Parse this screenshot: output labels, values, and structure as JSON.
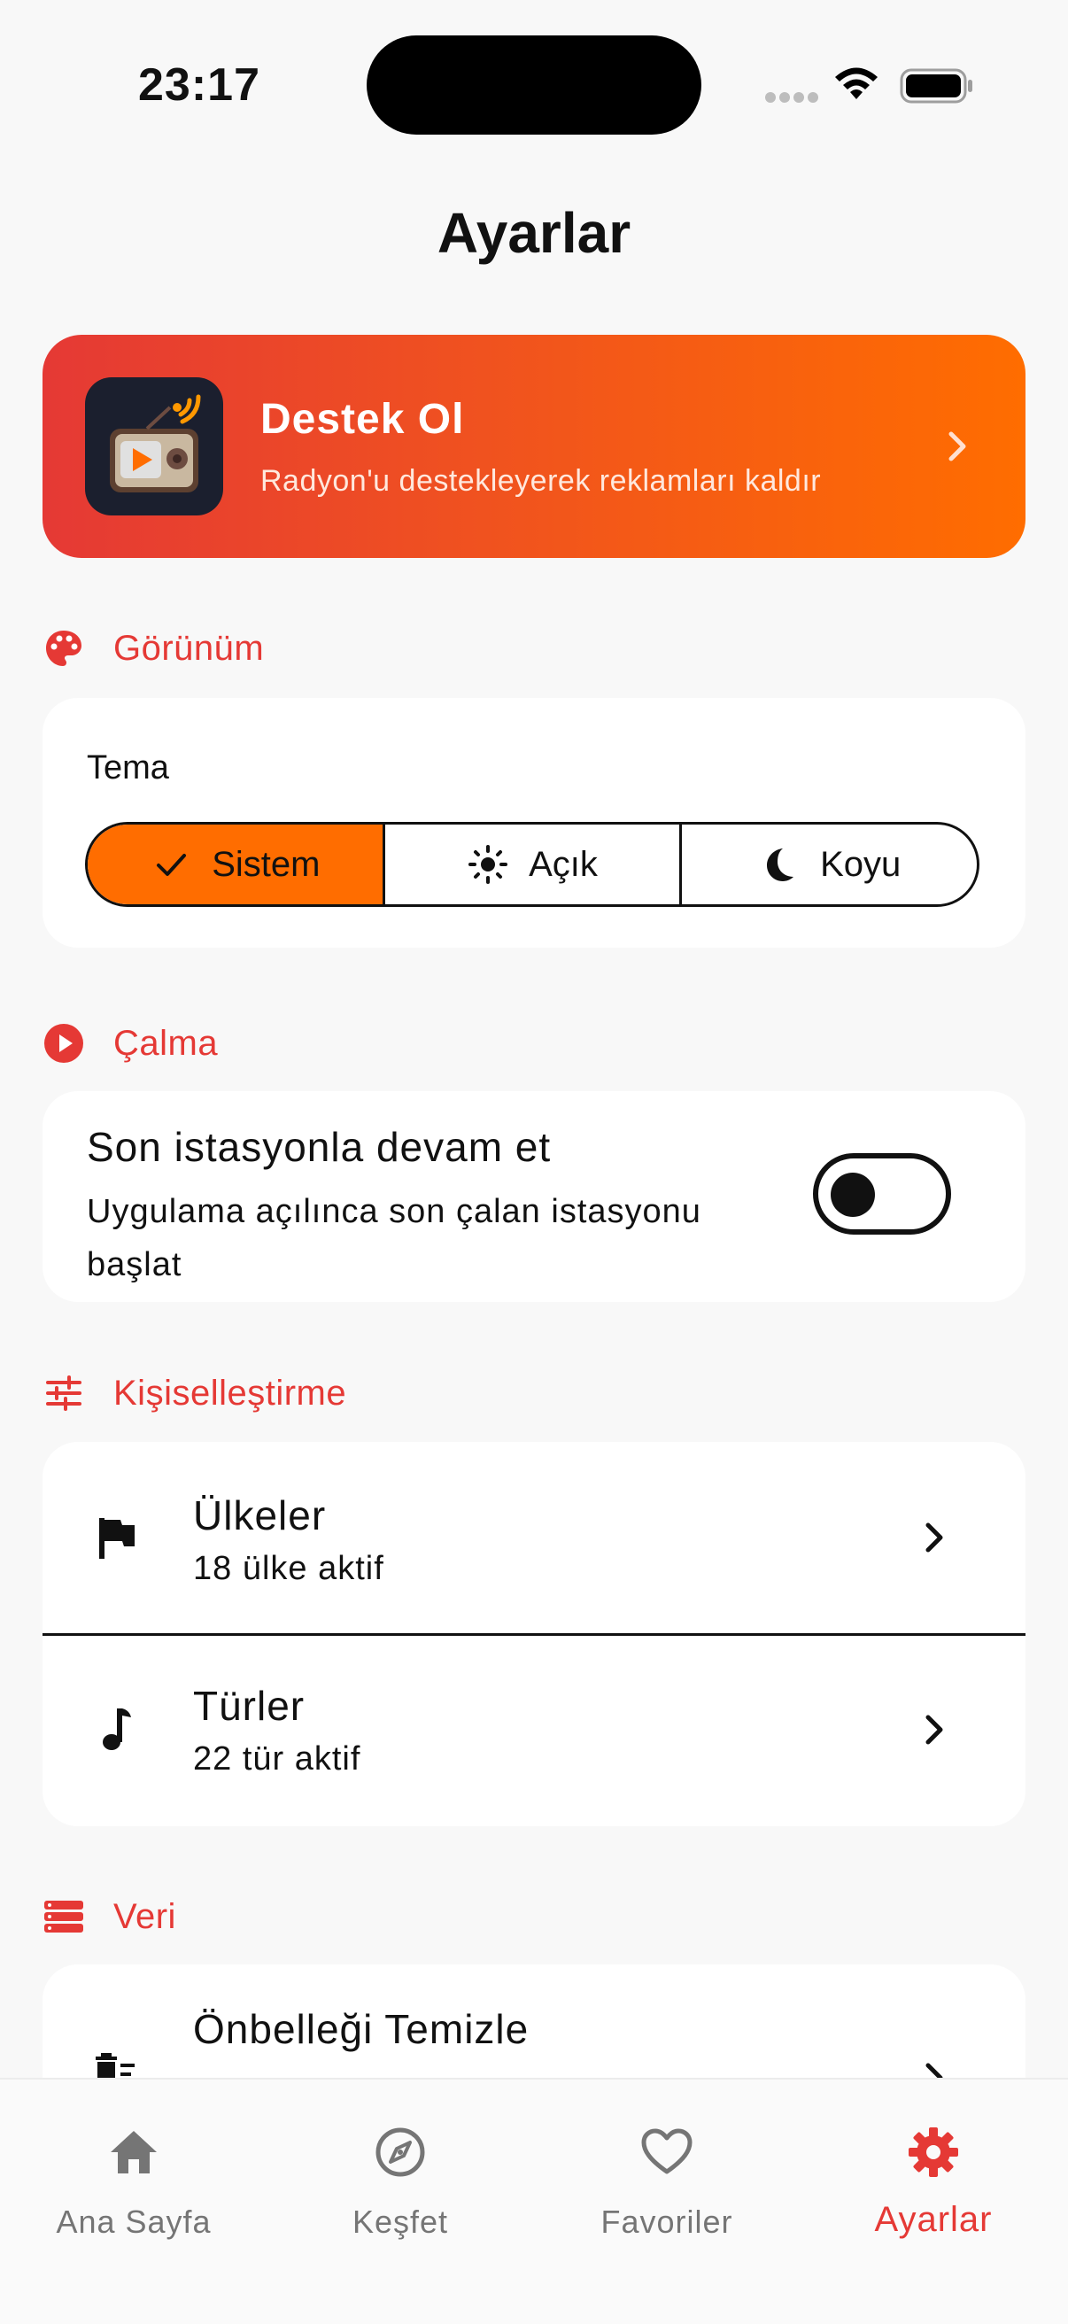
{
  "status_bar": {
    "time": "23:17"
  },
  "page": {
    "title": "Ayarlar"
  },
  "support_banner": {
    "title": "Destek Ol",
    "subtitle": "Radyon'u destekleyerek reklamları kaldır",
    "icon": "radio-app-icon",
    "colors": {
      "start": "#e53935",
      "end": "#ff6d00"
    }
  },
  "appearance": {
    "section_label": "Görünüm",
    "icon": "palette-icon",
    "theme_label": "Tema",
    "theme_options": [
      {
        "label": "Sistem",
        "icon": "check-icon",
        "selected": true
      },
      {
        "label": "Açık",
        "icon": "sun-icon",
        "selected": false
      },
      {
        "label": "Koyu",
        "icon": "moon-icon",
        "selected": false
      }
    ]
  },
  "playback": {
    "section_label": "Çalma",
    "icon": "play-circle-icon",
    "resume_title": "Son istasyonla devam et",
    "resume_subtitle": "Uygulama açılınca son çalan istasyonu başlat",
    "resume_enabled": false
  },
  "personalization": {
    "section_label": "Kişiselleştirme",
    "icon": "tune-icon",
    "items": [
      {
        "title": "Ülkeler",
        "subtitle": "18 ülke aktif",
        "icon": "flag-icon"
      },
      {
        "title": "Türler",
        "subtitle": "22 tür aktif",
        "icon": "music-note-icon"
      }
    ]
  },
  "data_section": {
    "section_label": "Veri",
    "icon": "storage-icon",
    "items": [
      {
        "title": "Önbelleği Temizle",
        "icon": "clear-cache-icon"
      }
    ]
  },
  "bottom_nav": {
    "items": [
      {
        "label": "Ana Sayfa",
        "icon": "home-icon",
        "active": false
      },
      {
        "label": "Keşfet",
        "icon": "compass-icon",
        "active": false
      },
      {
        "label": "Favoriler",
        "icon": "heart-icon",
        "active": false
      },
      {
        "label": "Ayarlar",
        "icon": "gear-icon",
        "active": true
      }
    ]
  },
  "colors": {
    "accent": "#e53935",
    "orange": "#ff6d00",
    "background": "#f8f8f8",
    "card": "#ffffff"
  }
}
